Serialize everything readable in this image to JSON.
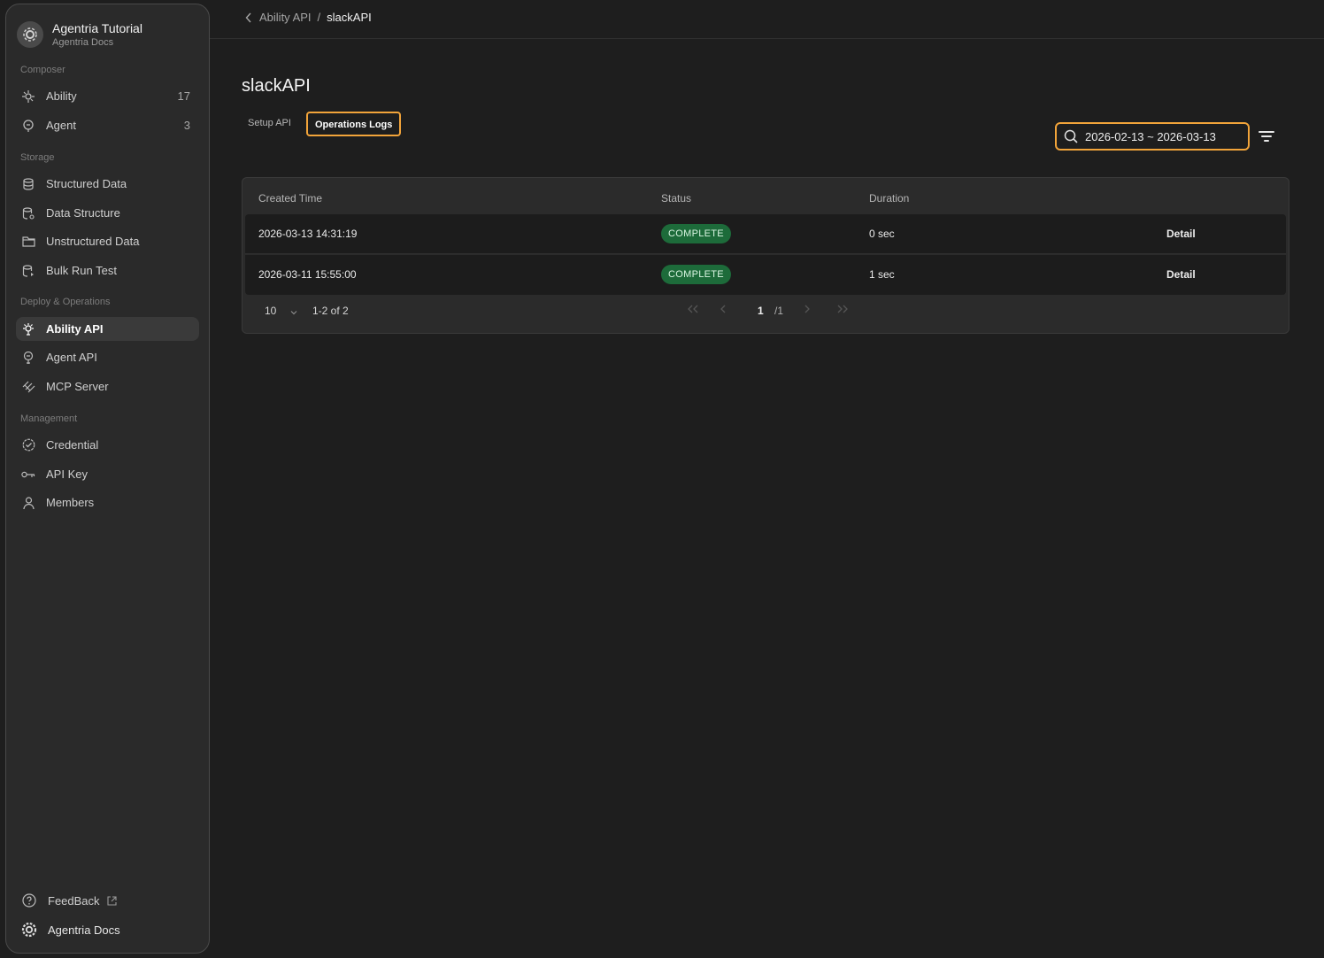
{
  "workspace": {
    "title": "Agentria Tutorial",
    "subtitle": "Agentria Docs"
  },
  "sidebar": {
    "sections": [
      {
        "label": "Composer"
      },
      {
        "label": "Storage"
      },
      {
        "label": "Deploy & Operations"
      },
      {
        "label": "Management"
      }
    ],
    "items": [
      {
        "label": "Ability",
        "count": "17",
        "icon": "ability-icon"
      },
      {
        "label": "Agent",
        "count": "3",
        "icon": "agent-icon"
      },
      {
        "label": "Structured Data",
        "icon": "database-icon"
      },
      {
        "label": "Data Structure",
        "icon": "data-structure-icon"
      },
      {
        "label": "Unstructured Data",
        "icon": "folder-icon"
      },
      {
        "label": "Bulk Run Test",
        "icon": "bulk-run-icon"
      },
      {
        "label": "Ability API",
        "icon": "ability-api-icon",
        "active": true
      },
      {
        "label": "Agent API",
        "icon": "agent-api-icon"
      },
      {
        "label": "MCP Server",
        "icon": "mcp-icon"
      },
      {
        "label": "Credential",
        "icon": "credential-icon"
      },
      {
        "label": "API Key",
        "icon": "key-icon"
      },
      {
        "label": "Members",
        "icon": "user-icon"
      }
    ],
    "bottom": [
      {
        "label": "FeedBack",
        "icon": "help-circle-icon"
      },
      {
        "label": "Agentria Docs",
        "icon": "gear-icon"
      }
    ]
  },
  "breadcrumb": {
    "parent": "Ability API",
    "separator": "/",
    "current": "slackAPI"
  },
  "page": {
    "title": "slackAPI"
  },
  "tabs": [
    {
      "label": "Setup API",
      "active": false
    },
    {
      "label": "Operations Logs",
      "active": true
    }
  ],
  "filter": {
    "date_range": "2026-02-13 ~ 2026-03-13"
  },
  "table": {
    "columns": [
      "Created Time",
      "Status",
      "Duration"
    ],
    "rows": [
      {
        "created": "2026-03-13 14:31:19",
        "status": "COMPLETE",
        "duration": "0 sec",
        "action": "Detail"
      },
      {
        "created": "2026-03-11 15:55:00",
        "status": "COMPLETE",
        "duration": "1 sec",
        "action": "Detail"
      }
    ]
  },
  "pagination": {
    "page_size": "10",
    "range": "1-2 of 2",
    "current_page": "1",
    "total_pages": "/1"
  },
  "colors": {
    "accent_highlight": "#f2a43a",
    "status_complete": "#1d6b3a",
    "background": "#1e1e1e",
    "sidebar": "#2a2a2a"
  }
}
